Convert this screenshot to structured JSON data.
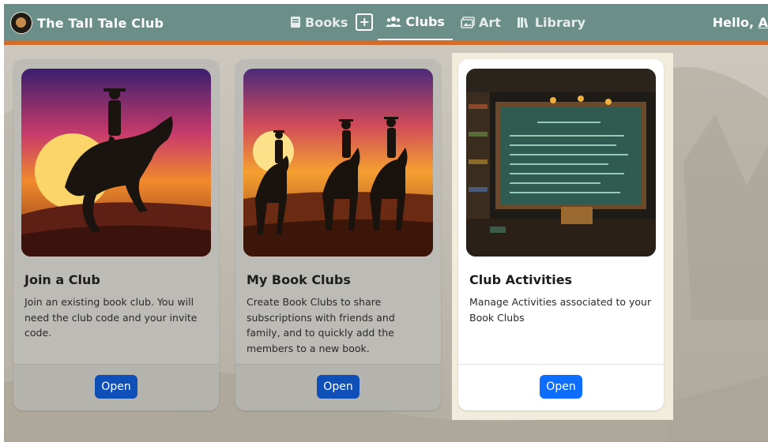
{
  "navbar": {
    "brand_title": "The Tall Tale Club",
    "items": [
      {
        "label": "Books",
        "icon": "book-icon"
      },
      {
        "label": "Clubs",
        "icon": "users-icon",
        "active": true
      },
      {
        "label": "Art",
        "icon": "images-icon"
      },
      {
        "label": "Library",
        "icon": "library-icon"
      }
    ],
    "add_label": "+",
    "greeting_prefix": "Hello, ",
    "greeting_user": "A"
  },
  "cards": [
    {
      "title": "Join a Club",
      "description": "Join an existing book club. You will need the club code and your invite code.",
      "button": "Open",
      "image": "cowboy-on-rearing-horse-sunset"
    },
    {
      "title": "My Book Clubs",
      "description": "Create Book Clubs to share subscriptions with friends and family, and to quickly add the members to a new book.",
      "button": "Open",
      "image": "four-riders-sunset"
    },
    {
      "title": "Club Activities",
      "description": "Manage Activities associated to your Book Clubs",
      "button": "Open",
      "image": "classroom-chalkboard"
    }
  ],
  "colors": {
    "navbar": "#6b8f88",
    "navbar_accent": "#d36c2a",
    "button_primary": "#0d6efd"
  }
}
